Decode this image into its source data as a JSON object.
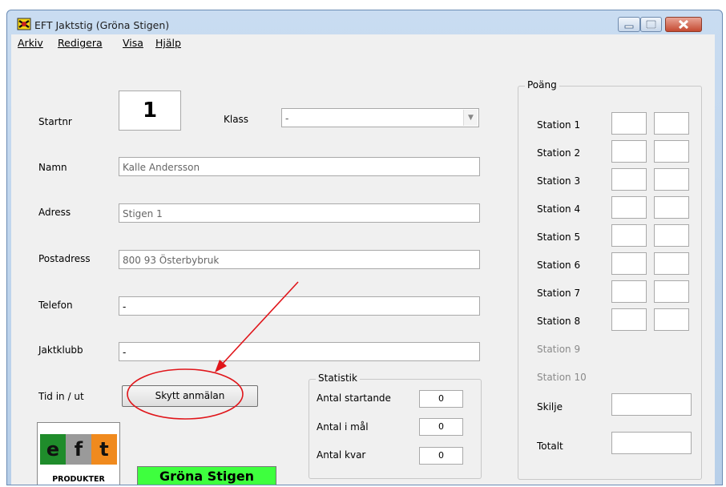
{
  "window": {
    "title": "EFT Jaktstig (Gröna Stigen)",
    "icon": "eft-app-icon",
    "controls": [
      "minimize",
      "maximize",
      "close"
    ]
  },
  "menu": [
    "Arkiv",
    "Redigera",
    "Visa",
    "Hjälp"
  ],
  "form": {
    "startnr_label": "Startnr",
    "startnr_value": "1",
    "klass_label": "Klass",
    "klass_value": "-",
    "namn_label": "Namn",
    "namn_value": "Kalle Andersson",
    "adress_label": "Adress",
    "adress_value": "Stigen 1",
    "postadress_label": "Postadress",
    "postadress_value": "800 93 Österbybruk",
    "telefon_label": "Telefon",
    "telefon_value": "-",
    "jaktklubb_label": "Jaktklubb",
    "jaktklubb_value": "-",
    "tid_label": "Tid in / ut",
    "skytt_button": "Skytt anmälan"
  },
  "statistik": {
    "title": "Statistik",
    "rows": [
      {
        "label": "Antal startande",
        "value": "0"
      },
      {
        "label": "Antal i mål",
        "value": "0"
      },
      {
        "label": "Antal kvar",
        "value": "0"
      }
    ]
  },
  "poang": {
    "title": "Poäng",
    "stations": [
      "Station 1",
      "Station 2",
      "Station 3",
      "Station 4",
      "Station 5",
      "Station 6",
      "Station 7",
      "Station 8"
    ],
    "disabled_stations": [
      "Station 9",
      "Station 10"
    ],
    "skilje_label": "Skilje",
    "totalt_label": "Totalt"
  },
  "logo": {
    "letters": [
      "e",
      "f",
      "t"
    ],
    "colors": [
      "#1f8c2b",
      "#9a9a9a",
      "#f08a1e"
    ],
    "caption": "PRODUKTER"
  },
  "banner": {
    "text": "Gröna Stigen",
    "color": "#3eff3e"
  },
  "annotation": {
    "color": "#e0151a"
  }
}
